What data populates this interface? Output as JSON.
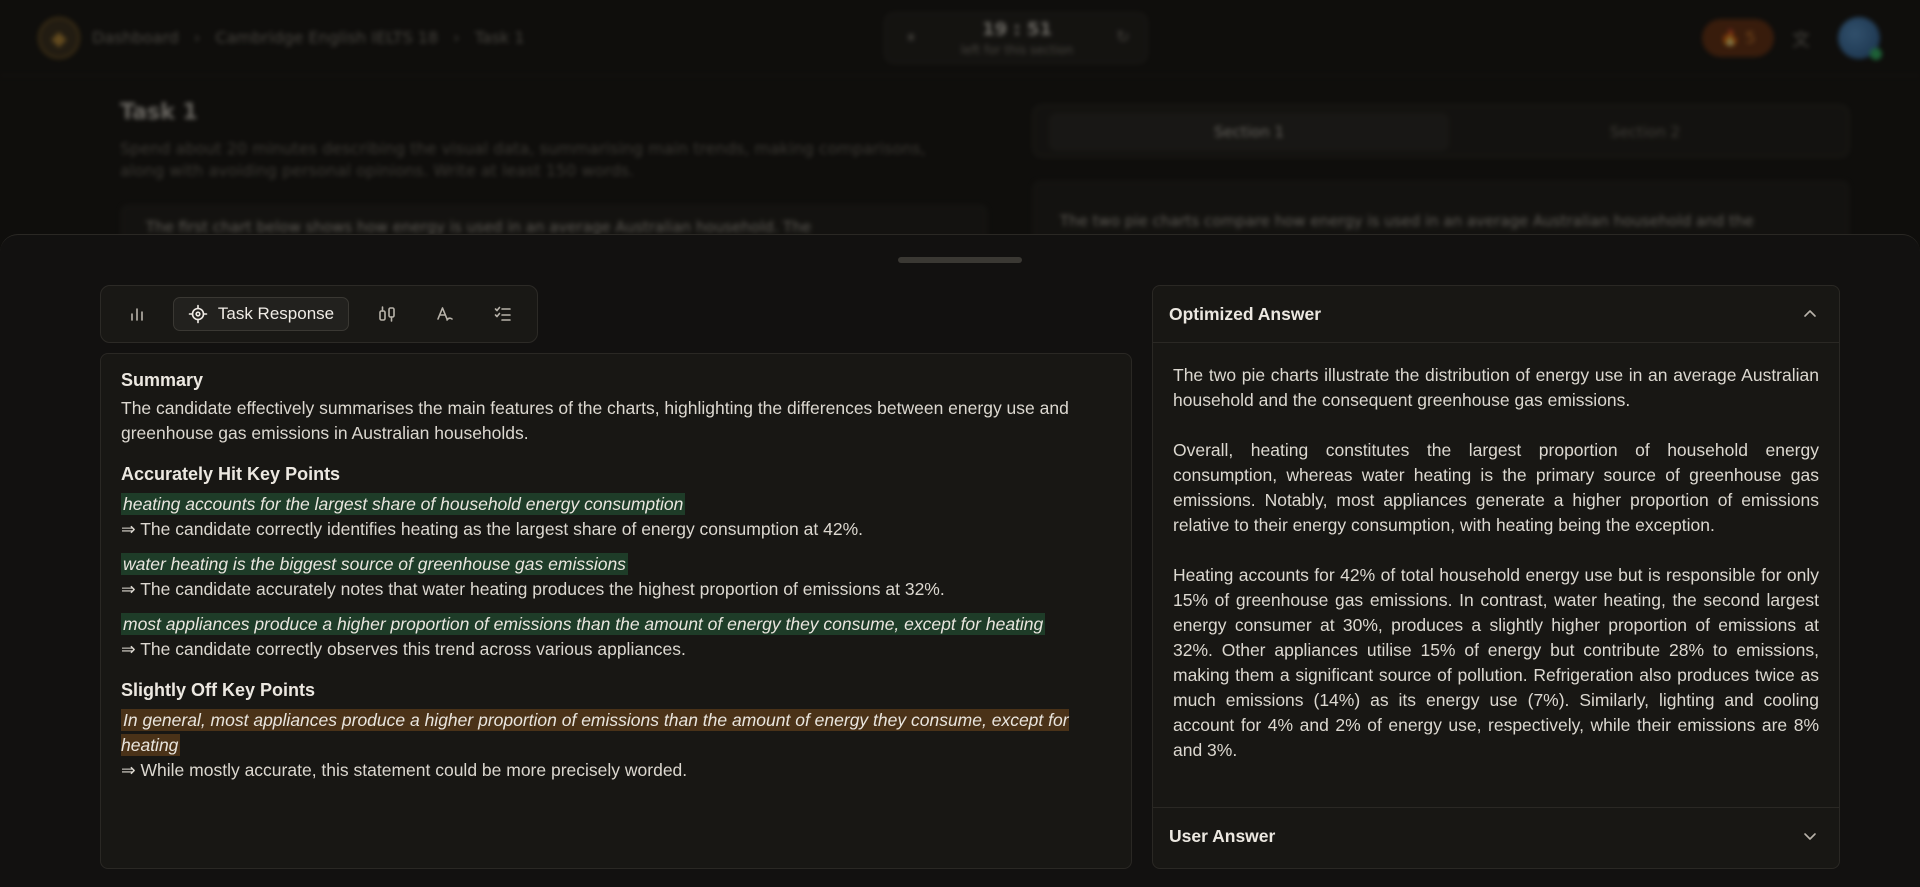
{
  "background": {
    "breadcrumb": [
      "Dashboard",
      "›",
      "Cambridge English IELTS 18",
      "›",
      "Task 1"
    ],
    "timer": {
      "main": "19 : 51",
      "sub": "left for this section"
    },
    "streak": "🔥 5",
    "task_title": "Task 1",
    "task_desc": "Spend about 20 minutes describing the visual data, summarising main trends, making comparisons, along with avoiding personal opinions. Write at least 150 words.",
    "task_prompt": "The first chart below shows how energy is used in an average Australian household. The",
    "section_tabs": [
      "Section 1",
      "Section 2"
    ],
    "right_preview": "The two pie charts compare how energy is used in an average Australian household and the"
  },
  "toolbar": {
    "active_label": "Task Response"
  },
  "feedback": {
    "summary_title": "Summary",
    "summary_text": "The candidate effectively summarises the main features of the charts, highlighting the differences between energy use and greenhouse gas emissions in Australian households.",
    "hit_title": "Accurately Hit Key Points",
    "hit_points": [
      {
        "quote": "heating accounts for the largest share of household energy consumption",
        "note": "⇒ The candidate correctly identifies heating as the largest share of energy consumption at 42%."
      },
      {
        "quote": "water heating is the biggest source of greenhouse gas emissions",
        "note": "⇒ The candidate accurately notes that water heating produces the highest proportion of emissions at 32%."
      },
      {
        "quote": "most appliances produce a higher proportion of emissions than the amount of energy they consume, except for heating",
        "note": "⇒ The candidate correctly observes this trend across various appliances."
      }
    ],
    "off_title": "Slightly Off Key Points",
    "off_points": [
      {
        "quote": "In general, most appliances produce a higher proportion of emissions than the amount of energy they consume, except for heating",
        "note": "⇒ While mostly accurate, this statement could be more precisely worded."
      }
    ]
  },
  "optimized": {
    "title": "Optimized Answer",
    "paragraphs": [
      "The two pie charts illustrate the distribution of energy use in an average Australian household and the consequent greenhouse gas emissions.",
      "Overall, heating constitutes the largest proportion of household energy consumption, whereas water heating is the primary source of greenhouse gas emissions. Notably, most appliances generate a higher proportion of emissions relative to their energy consumption, with heating being the exception.",
      "Heating accounts for 42% of total household energy use but is responsible for only 15% of greenhouse gas emissions. In contrast, water heating, the second largest energy consumer at 30%, produces a slightly higher proportion of emissions at 32%. Other appliances utilise 15% of energy but contribute 28% to emissions, making them a significant source of pollution. Refrigeration also produces twice as much emissions (14%) as its energy use (7%). Similarly, lighting and cooling account for 4% and 2% of energy use, respectively, while their emissions are 8% and 3%."
    ]
  },
  "user_answer": {
    "title": "User Answer"
  }
}
